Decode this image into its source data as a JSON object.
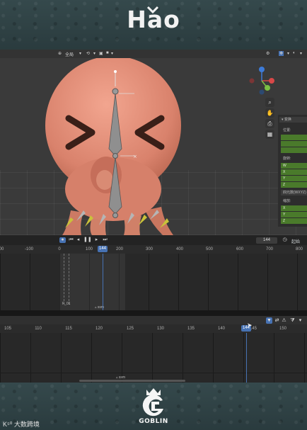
{
  "brand": {
    "top_logo": "Hao",
    "bottom_logo": "GOBLIN",
    "watermark": "K⁵⁰ 大数跨境"
  },
  "viewport_header": {
    "view_mode": "全局",
    "shading_label": "▾"
  },
  "npanel": {
    "section_title": "变换",
    "location_label": "位置:",
    "rotation_label": "旋转:",
    "rotation_mode": "四元数(WXYZ)",
    "scale_label": "缩放:",
    "axes_wxyz": [
      "W",
      "X",
      "Y",
      "Z"
    ],
    "axes_xyz": [
      "X",
      "Y",
      "Z"
    ]
  },
  "timeline": {
    "current_frame": "144",
    "start_label": "起始",
    "ruler_ticks": [
      "00",
      "-100",
      "0",
      "100",
      "144",
      "200",
      "300",
      "400",
      "500",
      "600",
      "700",
      "800"
    ],
    "marker_label": "F_01",
    "marker_label_2": "ssm"
  },
  "dopesheet": {
    "ruler_ticks": [
      "105",
      "110",
      "115",
      "120",
      "125",
      "130",
      "135",
      "140",
      "144",
      "145",
      "150"
    ],
    "current_frame": "144",
    "marker_label": "ssm"
  },
  "colors": {
    "accent_blue": "#4772b3",
    "panel_green": "#4a7a2b",
    "skin": "#e3907a"
  }
}
